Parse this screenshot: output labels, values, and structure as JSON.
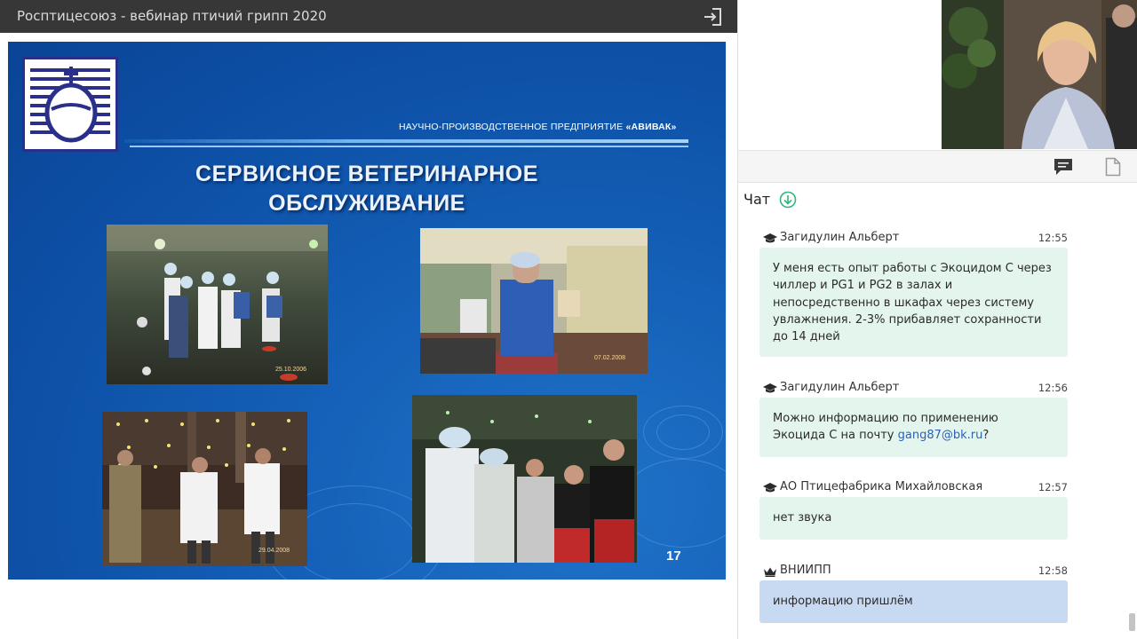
{
  "window": {
    "title": "Росптицесоюз - вебинар птичий грипп 2020"
  },
  "slide": {
    "company_prefix": "НАУЧНО-ПРОИЗВОДСТВЕННОЕ  ПРЕДПРИЯТИЕ",
    "company_name": "«АВИВАК»",
    "heading_line1": "СЕРВИСНОЕ ВЕТЕРИНАРНОЕ",
    "heading_line2": "ОБСЛУЖИВАНИЕ",
    "photo_dates": [
      "25.10.2006",
      "07.02.2008",
      "29.04.2008"
    ],
    "page_number": "17"
  },
  "chat": {
    "title": "Чат",
    "messages": [
      {
        "author": "Загидулин Альберт",
        "time": "12:55",
        "lines": [
          "У меня есть опыт работы с Экоцидом С через",
          "чиллер и PG1 и PG2 в залах и",
          "непосредственно в шкафах через систему",
          "увлажнения. 2-3% прибавляет сохранности",
          "до 14 дней"
        ]
      },
      {
        "author": "Загидулин Альберт",
        "time": "12:56",
        "line1": "Можно информацию по применению",
        "line2_prefix": "Экоцида С на почту ",
        "email": "gang87@bk.ru",
        "line2_suffix": "?"
      },
      {
        "author": "АО Птицефабрика Михайловская",
        "time": "12:57",
        "text": "нет звука"
      },
      {
        "author": "ВНИИПП",
        "time": "12:58",
        "text": "информацию пришлём"
      }
    ]
  },
  "icons": {
    "exit": "sign-in-icon",
    "chat": "chat-bubble-icon",
    "notes": "document-icon",
    "chat_down": "arrow-down-circle-icon",
    "student": "graduation-cap-icon",
    "moderator": "crown-icon"
  },
  "colors": {
    "titlebar": "#373737",
    "slide_blue": "#1560b8",
    "bubble_green": "#e4f5ed",
    "bubble_blue": "#c8daf2",
    "accent_green": "#2fb67a",
    "link": "#2a62b8"
  }
}
